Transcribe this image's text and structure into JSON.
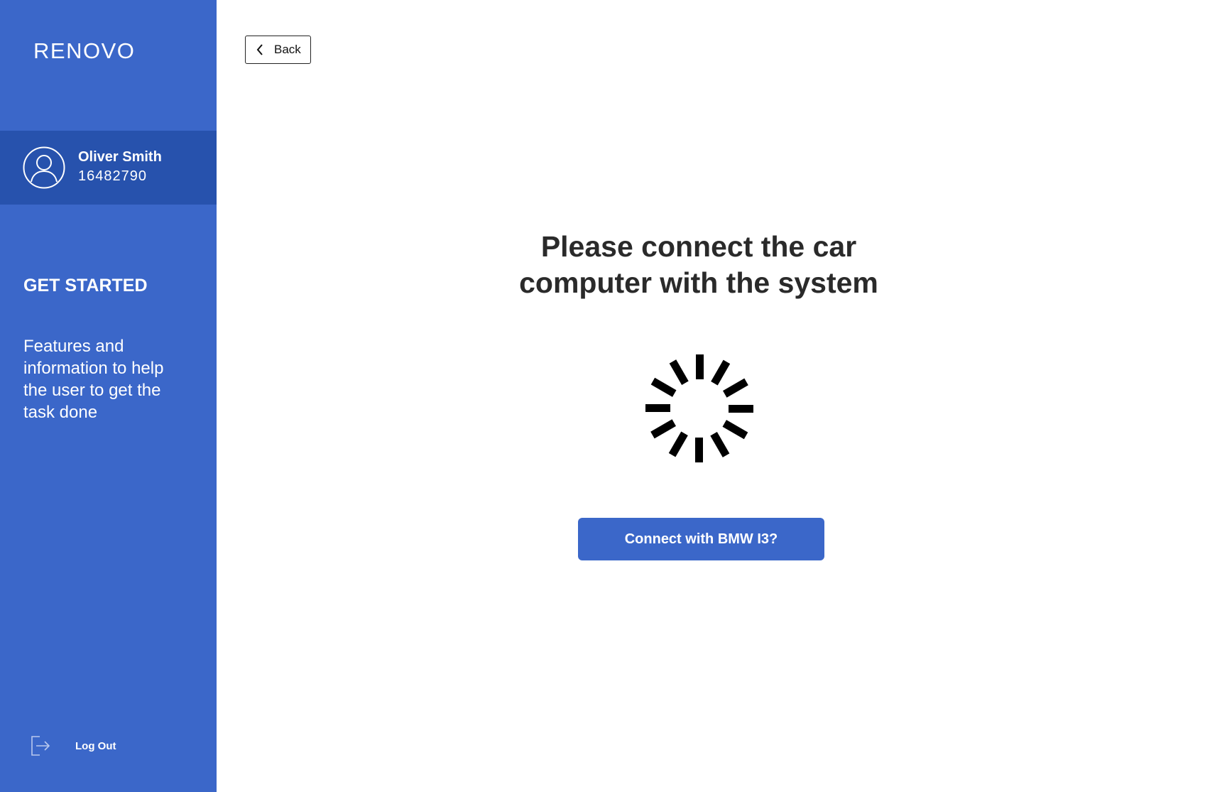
{
  "sidebar": {
    "logo": "RENOVO",
    "user": {
      "name": "Oliver Smith",
      "id": "16482790"
    },
    "section_title": "GET STARTED",
    "section_text": "Features and information to help the user to get the task done",
    "logout_label": "Log Out"
  },
  "main": {
    "back_label": "Back",
    "headline_line1": "Please connect the car",
    "headline_line2": "computer with the system",
    "connect_button_label": "Connect with BMW I3?"
  },
  "colors": {
    "brand_blue": "#3b67c9",
    "user_panel_blue": "#2752ad"
  },
  "icons": {
    "avatar": "user-circle-icon",
    "logout": "logout-icon",
    "back": "chevron-left-icon",
    "loading": "loading-spinner-icon"
  }
}
